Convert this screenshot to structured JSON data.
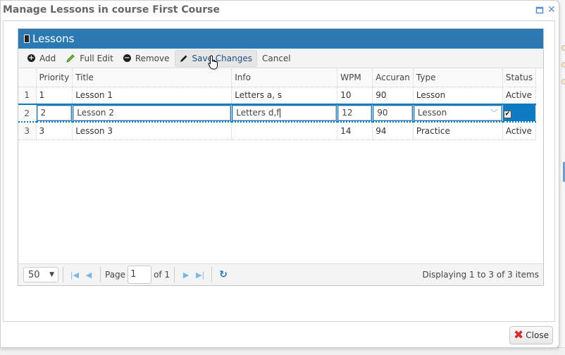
{
  "window": {
    "title": "Manage Lessons in course First Course",
    "maximize_icon": "maximize-icon",
    "close_icon": "close-icon"
  },
  "panel": {
    "title": "Lessons",
    "icon": "book-icon"
  },
  "toolbar": {
    "add_label": "Add",
    "full_edit_label": "Full Edit",
    "remove_label": "Remove",
    "save_label": "Save Changes",
    "cancel_label": "Cancel"
  },
  "grid": {
    "columns": [
      "",
      "Priority",
      "Title",
      "Info",
      "WPM",
      "Accuran",
      "Type",
      "Status"
    ],
    "rows": [
      {
        "rownum": "1",
        "priority": "1",
        "title": "Lesson 1",
        "info": "Letters a, s",
        "wpm": "10",
        "accuracy": "90",
        "type": "Lesson",
        "status": "Active"
      },
      {
        "rownum": "2",
        "priority": "2",
        "title": "Lesson 2",
        "info": "Letters d,f",
        "wpm": "12",
        "accuracy": "90",
        "type": "Lesson",
        "status": "checked"
      },
      {
        "rownum": "3",
        "priority": "3",
        "title": "Lesson 3",
        "info": "",
        "wpm": "14",
        "accuracy": "94",
        "type": "Practice",
        "status": "Active"
      }
    ]
  },
  "pager": {
    "page_size": "50",
    "page_label": "Page",
    "page_value": "1",
    "of_label": "of 1",
    "info": "Displaying 1 to 3 of 3 items"
  },
  "footer": {
    "close_label": "Close"
  },
  "colors": {
    "header_blue": "#2c78b0",
    "edit_row_blue": "#0e7bc1"
  }
}
